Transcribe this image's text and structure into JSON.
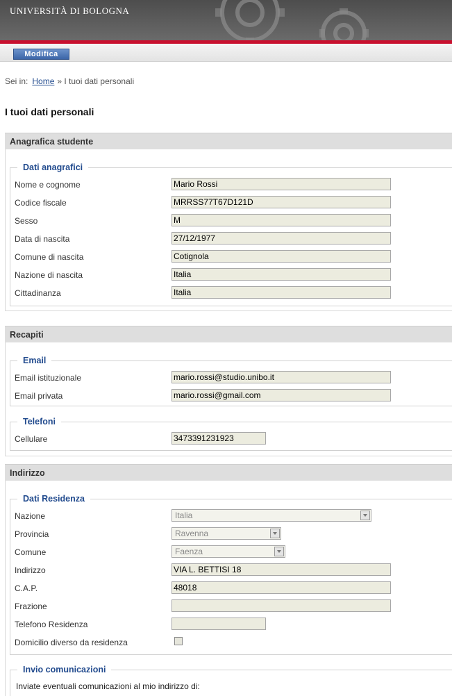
{
  "header": {
    "brand": "UNIVERSITÀ DI BOLOGNA"
  },
  "toolbar": {
    "modifica_label": "Modifica"
  },
  "breadcrumb": {
    "prefix": "Sei in:",
    "home": "Home",
    "current": "» I tuoi dati personali"
  },
  "page": {
    "title": "I tuoi dati personali"
  },
  "anagrafica": {
    "section": "Anagrafica studente",
    "legend": "Dati anagrafici",
    "fields": [
      {
        "label": "Nome e cognome",
        "value": "Mario Rossi"
      },
      {
        "label": "Codice fiscale",
        "value": "MRRSS77T67D121D"
      },
      {
        "label": "Sesso",
        "value": "M"
      },
      {
        "label": "Data di nascita",
        "value": "27/12/1977"
      },
      {
        "label": "Comune di nascita",
        "value": "Cotignola"
      },
      {
        "label": "Nazione di nascita",
        "value": "Italia"
      },
      {
        "label": "Cittadinanza",
        "value": "Italia"
      }
    ]
  },
  "recapiti": {
    "section": "Recapiti",
    "email_legend": "Email",
    "email_fields": [
      {
        "label": "Email istituzionale",
        "value": "mario.rossi@studio.unibo.it"
      },
      {
        "label": "Email privata",
        "value": "mario.rossi@gmail.com"
      }
    ],
    "telefoni_legend": "Telefoni",
    "telefoni_fields": [
      {
        "label": "Cellulare",
        "value": "3473391231923"
      }
    ]
  },
  "indirizzo": {
    "section": "Indirizzo",
    "legend": "Dati Residenza",
    "nazione": {
      "label": "Nazione",
      "value": "Italia"
    },
    "provincia": {
      "label": "Provincia",
      "value": "Ravenna"
    },
    "comune": {
      "label": "Comune",
      "value": "Faenza"
    },
    "indirizzo": {
      "label": "Indirizzo",
      "value": "VIA L. BETTISI 18"
    },
    "cap": {
      "label": "C.A.P.",
      "value": "48018"
    },
    "frazione": {
      "label": "Frazione",
      "value": ""
    },
    "telefono": {
      "label": "Telefono Residenza",
      "value": ""
    },
    "domicilio": {
      "label": "Domicilio diverso da residenza",
      "checked": false
    }
  },
  "comunicazioni": {
    "legend": "Invio comunicazioni",
    "note": "Inviate eventuali comunicazioni al mio indirizzo di:"
  }
}
